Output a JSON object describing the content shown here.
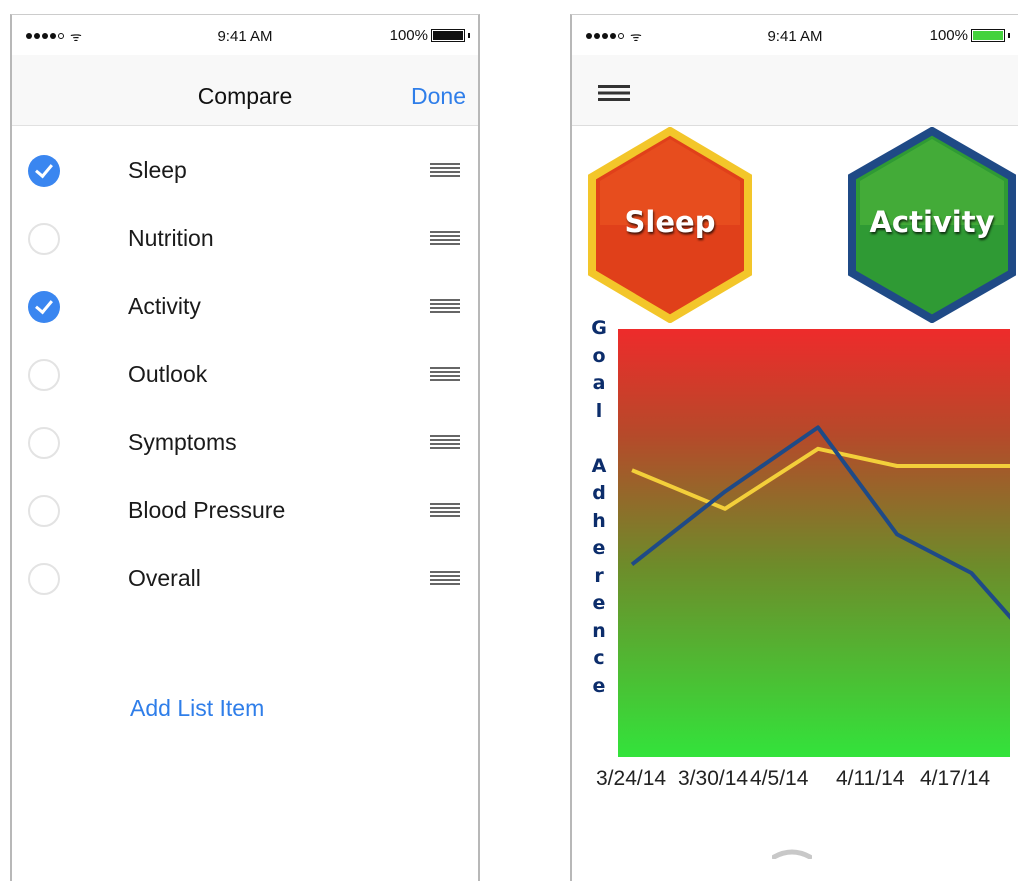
{
  "left_screen": {
    "status": {
      "time": "9:41 AM",
      "battery": "100%"
    },
    "nav": {
      "title": "Compare",
      "done_label": "Done"
    },
    "items": [
      {
        "label": "Sleep",
        "checked": true
      },
      {
        "label": "Nutrition",
        "checked": false
      },
      {
        "label": "Activity",
        "checked": true
      },
      {
        "label": "Outlook",
        "checked": false
      },
      {
        "label": "Symptoms",
        "checked": false
      },
      {
        "label": "Blood Pressure",
        "checked": false
      },
      {
        "label": "Overall",
        "checked": false
      }
    ],
    "add_item_label": "Add List Item"
  },
  "right_screen": {
    "status": {
      "time": "9:41 AM",
      "battery": "100%"
    },
    "badges": [
      {
        "label": "Sleep",
        "color": "#e0401a",
        "border": "#f3c62a"
      },
      {
        "label": "Activity",
        "color": "#2f9a34",
        "border": "#1f4a86"
      }
    ]
  },
  "chart_data": {
    "type": "line",
    "ylabel": "Goal Adherence",
    "xlabel": "",
    "x": [
      "3/24/14",
      "3/30/14",
      "4/5/14",
      "4/11/14",
      "4/17/14"
    ],
    "xtick_labels": [
      "3/24/14",
      "3/30/14",
      "4/5/14",
      "4/11/14",
      "4/17/14"
    ],
    "series": [
      {
        "color": "#f3cf3a",
        "values": [
          0.67,
          0.58,
          0.72,
          0.68,
          0.68,
          0.68,
          0.76
        ]
      },
      {
        "color": "#1f4a86",
        "values": [
          0.45,
          0.62,
          0.77,
          0.52,
          0.43,
          0.22,
          0.18
        ]
      }
    ],
    "sample_positions": [
      0,
      1,
      2,
      2.85,
      3.65,
      4.5,
      5
    ],
    "ylim": [
      0,
      1
    ],
    "grid": false,
    "legend": "none"
  },
  "colors": {
    "accent": "#2f7ee9",
    "check_on": "#3a86f0"
  }
}
